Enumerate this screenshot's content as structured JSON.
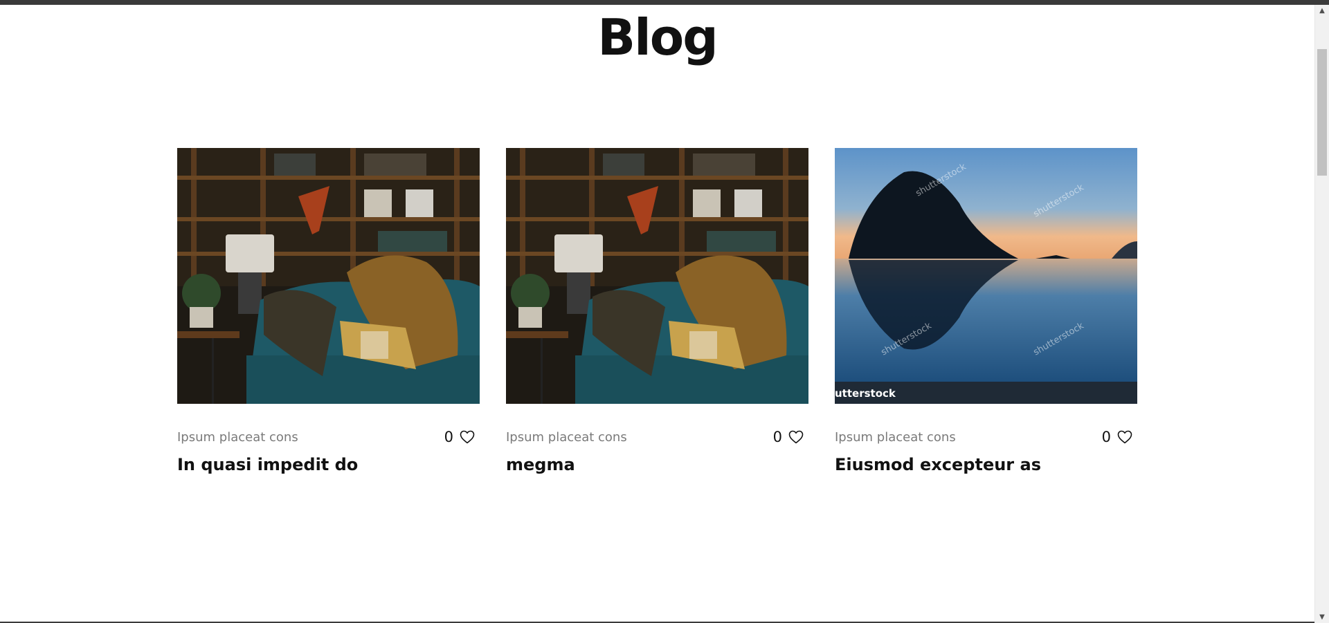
{
  "page": {
    "title": "Blog"
  },
  "posts": [
    {
      "category": "Ipsum placeat cons",
      "likes": "0",
      "title": "In quasi impedit do",
      "image": "living-room-photo"
    },
    {
      "category": "Ipsum placeat cons",
      "likes": "0",
      "title": "megma",
      "image": "living-room-photo"
    },
    {
      "category": "Ipsum placeat cons",
      "likes": "0",
      "title": "Eiusmod excepteur as",
      "image": "sea-rock-sunset-photo",
      "watermark": "shutterstock"
    }
  ],
  "colors": {
    "text": "#111111",
    "muted": "#7a7a7a",
    "topbar": "#3a3a3a"
  },
  "icons": {
    "like": "heart-icon"
  }
}
